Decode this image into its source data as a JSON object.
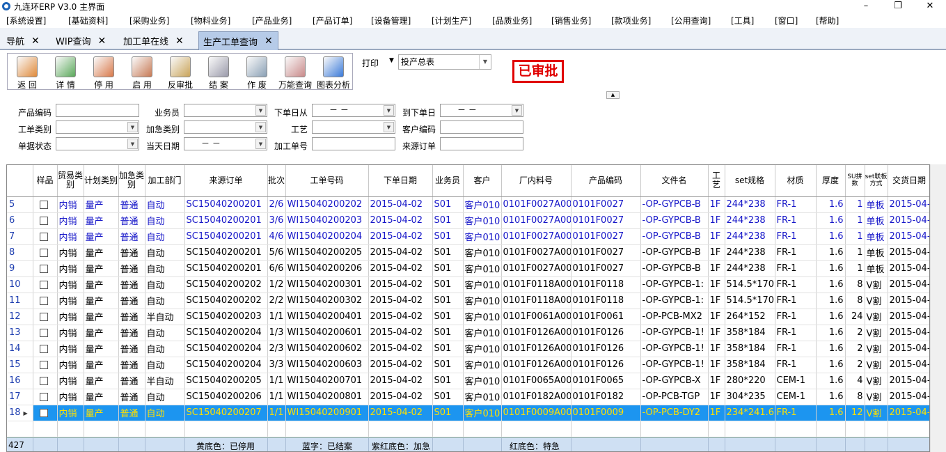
{
  "window": {
    "title": "九连环ERP V3.0 主界面",
    "min": "–",
    "max": "❐",
    "close": "✕"
  },
  "menu": [
    "[系统设置]",
    "[基础资料]",
    "[采购业务]",
    "[物料业务]",
    "[产品业务]",
    "[产品订单]",
    "[设备管理]",
    "[计划生产]",
    "[品质业务]",
    "[销售业务]",
    "[款项业务]",
    "[公用查询]",
    "[工具]",
    "[窗口]",
    "[帮助]"
  ],
  "tabs": [
    {
      "label": "导航"
    },
    {
      "label": "WIP查询"
    },
    {
      "label": "加工单在线"
    },
    {
      "label": "生产工单查询"
    }
  ],
  "tab_close": "✕",
  "toolbar": [
    {
      "label": "返 回",
      "icon": "exit-door-icon",
      "color": "#e08a3a"
    },
    {
      "label": "详 情",
      "icon": "layers-icon",
      "color": "#5aa85a"
    },
    {
      "label": "停 用",
      "icon": "stop-icon",
      "color": "#d9794a"
    },
    {
      "label": "启 用",
      "icon": "start-icon",
      "color": "#c77a55"
    },
    {
      "label": "反审批",
      "icon": "unapprove-icon",
      "color": "#c9a45a"
    },
    {
      "label": "结 案",
      "icon": "close-case-icon",
      "color": "#9a9aaa"
    },
    {
      "label": "作 废",
      "icon": "void-icon",
      "color": "#8aa0b5"
    },
    {
      "label": "万能查询",
      "icon": "magnifier-icon",
      "color": "#c98a8a"
    },
    {
      "label": "图表分析",
      "icon": "chart-analysis-icon",
      "color": "#3a7ad9"
    }
  ],
  "print": {
    "label": "打印",
    "selected": "投产总表"
  },
  "status_stamp": "已审批",
  "filters": {
    "product_code": {
      "label": "产品编码",
      "value": ""
    },
    "salesman": {
      "label": "业务员",
      "value": ""
    },
    "order_date_from": {
      "label": "下单日从",
      "value": "－ －"
    },
    "order_date_to": {
      "label": "到下单日",
      "value": "－ －"
    },
    "order_type": {
      "label": "工单类别",
      "value": ""
    },
    "urgent_type": {
      "label": "加急类别",
      "value": ""
    },
    "process": {
      "label": "工艺",
      "value": ""
    },
    "customer_code": {
      "label": "客户编码",
      "value": ""
    },
    "doc_status": {
      "label": "单据状态",
      "value": ""
    },
    "same_day": {
      "label": "当天日期",
      "value": "－ －"
    },
    "work_order_no": {
      "label": "加工单号",
      "value": ""
    },
    "source_order": {
      "label": "来源订单",
      "value": ""
    }
  },
  "columns": [
    "",
    "样品",
    "贸易类别",
    "计划类别",
    "加急类别",
    "加工部门",
    "来源订单",
    "批次",
    "工单号码",
    "下单日期",
    "业务员",
    "客户",
    "厂内料号",
    "产品编码",
    "文件名",
    "工艺",
    "set规格",
    "材质",
    "厚度",
    "SU拼数",
    "set联板方式",
    "交货日期"
  ],
  "rows": [
    {
      "n": "5",
      "trade": "内销",
      "plan": "量产",
      "urgent": "普通",
      "dept": "自动",
      "src": "SC15040200201",
      "batch": "2/6",
      "wo": "WI15040200202",
      "date": "2015-04-02",
      "sales": "S01",
      "cust": "客户010",
      "part": "0101F0027A00",
      "code": "0101F0027",
      "file": "-OP-GYPCB-B",
      "proc": "1F",
      "spec": "244*238",
      "mat": "FR-1",
      "thick": "1.6",
      "su": "1",
      "panel": "单板",
      "due": "2015-04-",
      "style": "blue"
    },
    {
      "n": "6",
      "trade": "内销",
      "plan": "量产",
      "urgent": "普通",
      "dept": "自动",
      "src": "SC15040200201",
      "batch": "3/6",
      "wo": "WI15040200203",
      "date": "2015-04-02",
      "sales": "S01",
      "cust": "客户010",
      "part": "0101F0027A00",
      "code": "0101F0027",
      "file": "-OP-GYPCB-B",
      "proc": "1F",
      "spec": "244*238",
      "mat": "FR-1",
      "thick": "1.6",
      "su": "1",
      "panel": "单板",
      "due": "2015-04-",
      "style": "blue"
    },
    {
      "n": "7",
      "trade": "内销",
      "plan": "量产",
      "urgent": "普通",
      "dept": "自动",
      "src": "SC15040200201",
      "batch": "4/6",
      "wo": "WI15040200204",
      "date": "2015-04-02",
      "sales": "S01",
      "cust": "客户010",
      "part": "0101F0027A00",
      "code": "0101F0027",
      "file": "-OP-GYPCB-B",
      "proc": "1F",
      "spec": "244*238",
      "mat": "FR-1",
      "thick": "1.6",
      "su": "1",
      "panel": "单板",
      "due": "2015-04-",
      "style": "blue"
    },
    {
      "n": "8",
      "trade": "内销",
      "plan": "量产",
      "urgent": "普通",
      "dept": "自动",
      "src": "SC15040200201",
      "batch": "5/6",
      "wo": "WI15040200205",
      "date": "2015-04-02",
      "sales": "S01",
      "cust": "客户010",
      "part": "0101F0027A00",
      "code": "0101F0027",
      "file": "-OP-GYPCB-B",
      "proc": "1F",
      "spec": "244*238",
      "mat": "FR-1",
      "thick": "1.6",
      "su": "1",
      "panel": "单板",
      "due": "2015-04-",
      "style": ""
    },
    {
      "n": "9",
      "trade": "内销",
      "plan": "量产",
      "urgent": "普通",
      "dept": "自动",
      "src": "SC15040200201",
      "batch": "6/6",
      "wo": "WI15040200206",
      "date": "2015-04-02",
      "sales": "S01",
      "cust": "客户010",
      "part": "0101F0027A00",
      "code": "0101F0027",
      "file": "-OP-GYPCB-B",
      "proc": "1F",
      "spec": "244*238",
      "mat": "FR-1",
      "thick": "1.6",
      "su": "1",
      "panel": "单板",
      "due": "2015-04-",
      "style": ""
    },
    {
      "n": "10",
      "trade": "内销",
      "plan": "量产",
      "urgent": "普通",
      "dept": "自动",
      "src": "SC15040200202",
      "batch": "1/2",
      "wo": "WI15040200301",
      "date": "2015-04-02",
      "sales": "S01",
      "cust": "客户010",
      "part": "0101F0118A00",
      "code": "0101F0118",
      "file": "-OP-GYPCB-1:",
      "proc": "1F",
      "spec": "514.5*170",
      "mat": "FR-1",
      "thick": "1.6",
      "su": "8",
      "panel": "V割",
      "due": "2015-04-",
      "style": ""
    },
    {
      "n": "11",
      "trade": "内销",
      "plan": "量产",
      "urgent": "普通",
      "dept": "自动",
      "src": "SC15040200202",
      "batch": "2/2",
      "wo": "WI15040200302",
      "date": "2015-04-02",
      "sales": "S01",
      "cust": "客户010",
      "part": "0101F0118A00",
      "code": "0101F0118",
      "file": "-OP-GYPCB-1:",
      "proc": "1F",
      "spec": "514.5*170",
      "mat": "FR-1",
      "thick": "1.6",
      "su": "8",
      "panel": "V割",
      "due": "2015-04-",
      "style": ""
    },
    {
      "n": "12",
      "trade": "内销",
      "plan": "量产",
      "urgent": "普通",
      "dept": "半自动",
      "src": "SC15040200203",
      "batch": "1/1",
      "wo": "WI15040200401",
      "date": "2015-04-02",
      "sales": "S01",
      "cust": "客户010",
      "part": "0101F0061A00",
      "code": "0101F0061",
      "file": "-OP-PCB-MX2",
      "proc": "1F",
      "spec": "264*152",
      "mat": "FR-1",
      "thick": "1.6",
      "su": "24",
      "panel": "V割",
      "due": "2015-04-",
      "style": ""
    },
    {
      "n": "13",
      "trade": "内销",
      "plan": "量产",
      "urgent": "普通",
      "dept": "自动",
      "src": "SC15040200204",
      "batch": "1/3",
      "wo": "WI15040200601",
      "date": "2015-04-02",
      "sales": "S01",
      "cust": "客户010",
      "part": "0101F0126A00",
      "code": "0101F0126",
      "file": "-OP-GYPCB-1!",
      "proc": "1F",
      "spec": "358*184",
      "mat": "FR-1",
      "thick": "1.6",
      "su": "2",
      "panel": "V割",
      "due": "2015-04-",
      "style": ""
    },
    {
      "n": "14",
      "trade": "内销",
      "plan": "量产",
      "urgent": "普通",
      "dept": "自动",
      "src": "SC15040200204",
      "batch": "2/3",
      "wo": "WI15040200602",
      "date": "2015-04-02",
      "sales": "S01",
      "cust": "客户010",
      "part": "0101F0126A00",
      "code": "0101F0126",
      "file": "-OP-GYPCB-1!",
      "proc": "1F",
      "spec": "358*184",
      "mat": "FR-1",
      "thick": "1.6",
      "su": "2",
      "panel": "V割",
      "due": "2015-04-",
      "style": ""
    },
    {
      "n": "15",
      "trade": "内销",
      "plan": "量产",
      "urgent": "普通",
      "dept": "自动",
      "src": "SC15040200204",
      "batch": "3/3",
      "wo": "WI15040200603",
      "date": "2015-04-02",
      "sales": "S01",
      "cust": "客户010",
      "part": "0101F0126A00",
      "code": "0101F0126",
      "file": "-OP-GYPCB-1!",
      "proc": "1F",
      "spec": "358*184",
      "mat": "FR-1",
      "thick": "1.6",
      "su": "2",
      "panel": "V割",
      "due": "2015-04-",
      "style": ""
    },
    {
      "n": "16",
      "trade": "内销",
      "plan": "量产",
      "urgent": "普通",
      "dept": "半自动",
      "src": "SC15040200205",
      "batch": "1/1",
      "wo": "WI15040200701",
      "date": "2015-04-02",
      "sales": "S01",
      "cust": "客户010",
      "part": "0101F0065A00",
      "code": "0101F0065",
      "file": "-OP-GYPCB-X",
      "proc": "1F",
      "spec": "280*220",
      "mat": "CEM-1",
      "thick": "1.6",
      "su": "4",
      "panel": "V割",
      "due": "2015-04-",
      "style": ""
    },
    {
      "n": "17",
      "trade": "内销",
      "plan": "量产",
      "urgent": "普通",
      "dept": "自动",
      "src": "SC15040200206",
      "batch": "1/1",
      "wo": "WI15040200801",
      "date": "2015-04-02",
      "sales": "S01",
      "cust": "客户010",
      "part": "0101F0182A00",
      "code": "0101F0182",
      "file": "-OP-PCB-TGP",
      "proc": "1F",
      "spec": "304*235",
      "mat": "CEM-1",
      "thick": "1.6",
      "su": "8",
      "panel": "V割",
      "due": "2015-04-",
      "style": ""
    },
    {
      "n": "18",
      "trade": "内销",
      "plan": "量产",
      "urgent": "普通",
      "dept": "自动",
      "src": "SC15040200207",
      "batch": "1/1",
      "wo": "WI15040200901",
      "date": "2015-04-02",
      "sales": "S01",
      "cust": "客户010",
      "part": "0101F0009A00",
      "code": "0101F0009",
      "file": "-OP-PCB-DY2",
      "proc": "1F",
      "spec": "234*241.6",
      "mat": "FR-1",
      "thick": "1.6",
      "su": "12",
      "panel": "V割",
      "due": "2015-04-",
      "style": "sel"
    }
  ],
  "footer": {
    "count": "427",
    "legend_yellow": "黄底色：已停用",
    "legend_blue": "蓝字：已结案",
    "legend_purple": "紫红底色：加急",
    "legend_red": "红底色：特急"
  },
  "colors": {
    "selected_row": "#1c95f0",
    "selected_text": "#ffe000",
    "closed_text": "#1515c8",
    "stamp": "#e00000"
  }
}
